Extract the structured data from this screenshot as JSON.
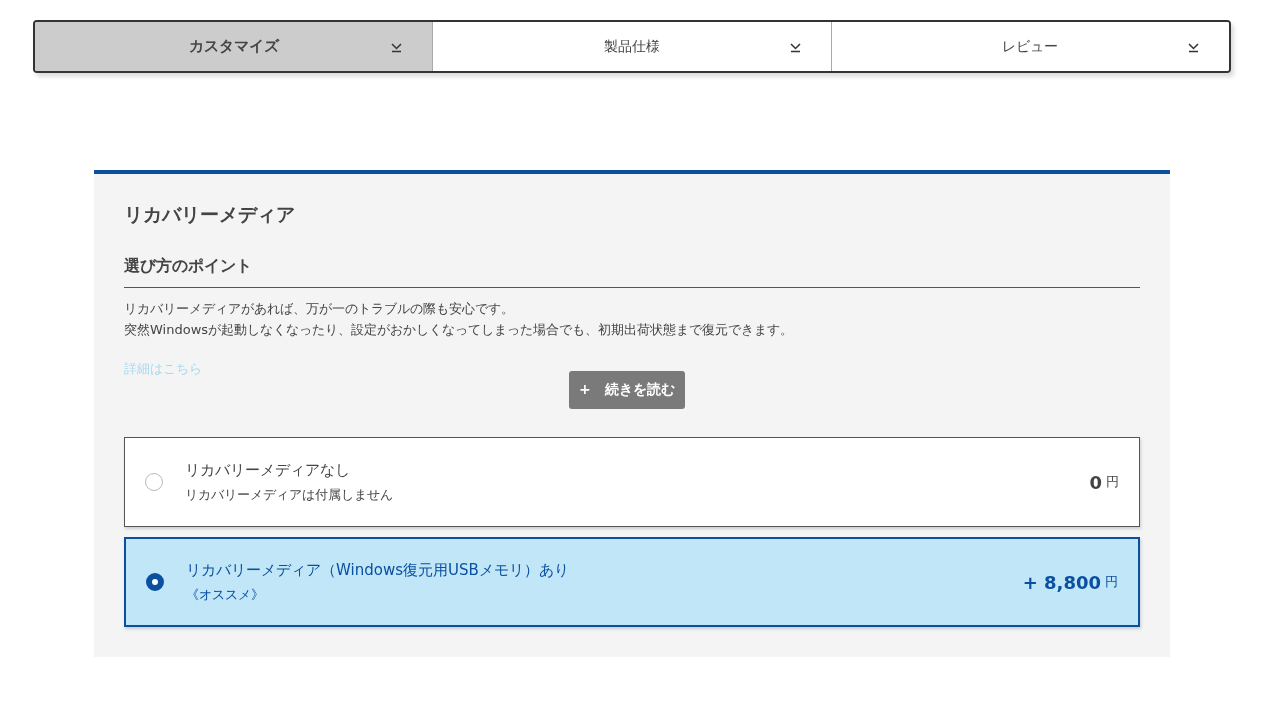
{
  "tabs": [
    {
      "label": "カスタマイズ",
      "selected": true
    },
    {
      "label": "製品仕様",
      "selected": false
    },
    {
      "label": "レビュー",
      "selected": false
    }
  ],
  "section": {
    "title": "リカバリーメディア",
    "subtitle": "選び方のポイント",
    "description": [
      "リカバリーメディアがあれば、万が一のトラブルの際も安心です。",
      "突然Windowsが起動しなくなったり、設定がおかしくなってしまった場合でも、初期出荷状態まで復元できます。"
    ],
    "link": "詳細はこちら",
    "read_more": {
      "icon": "+",
      "label": "続きを読む"
    },
    "options": [
      {
        "name": "リカバリーメディアなし",
        "note": "リカバリーメディアは付属しません",
        "price": "0",
        "unit": "円",
        "selected": false
      },
      {
        "name": "リカバリーメディア（Windows復元用USBメモリ）あり",
        "note": "《オススメ》",
        "price": "+ 8,800",
        "unit": "円",
        "selected": true
      }
    ]
  }
}
